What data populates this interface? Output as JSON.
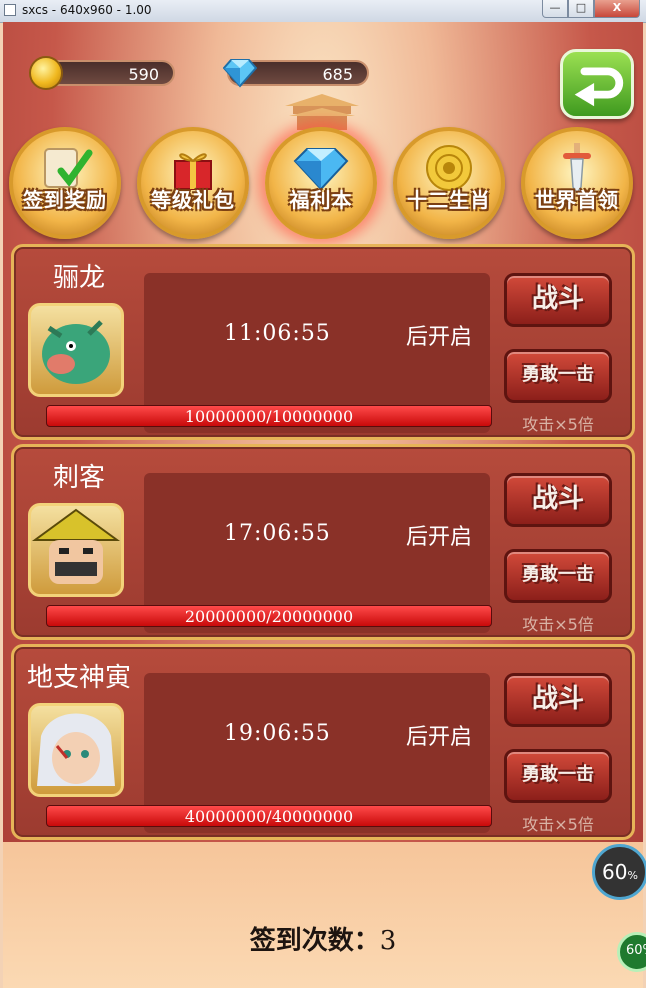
{
  "window": {
    "title": "sxcs - 640x960 - 1.00",
    "min_label": "—",
    "max_label": "□",
    "close_label": "X"
  },
  "currency": {
    "coins": "590",
    "gems": "685"
  },
  "menu": [
    {
      "label": "签到奖励"
    },
    {
      "label": "等级礼包"
    },
    {
      "label": "福利本"
    },
    {
      "label": "十二生肖"
    },
    {
      "label": "世界首领"
    }
  ],
  "bosses": [
    {
      "name": "骊龙",
      "timer": "11:06:55",
      "after": "后开启",
      "hp": "10000000/10000000",
      "fight": "战斗",
      "brave": "勇敢一击",
      "mult": "攻击×5倍"
    },
    {
      "name": "刺客",
      "timer": "17:06:55",
      "after": "后开启",
      "hp": "20000000/20000000",
      "fight": "战斗",
      "brave": "勇敢一击",
      "mult": "攻击×5倍"
    },
    {
      "name": "地支神寅",
      "timer": "19:06:55",
      "after": "后开启",
      "hp": "40000000/40000000",
      "fight": "战斗",
      "brave": "勇敢一击",
      "mult": "攻击×5倍"
    }
  ],
  "signin": {
    "label": "签到次数：",
    "count": "3"
  },
  "fps": {
    "main": "60",
    "unit": "%",
    "small": "60%"
  }
}
